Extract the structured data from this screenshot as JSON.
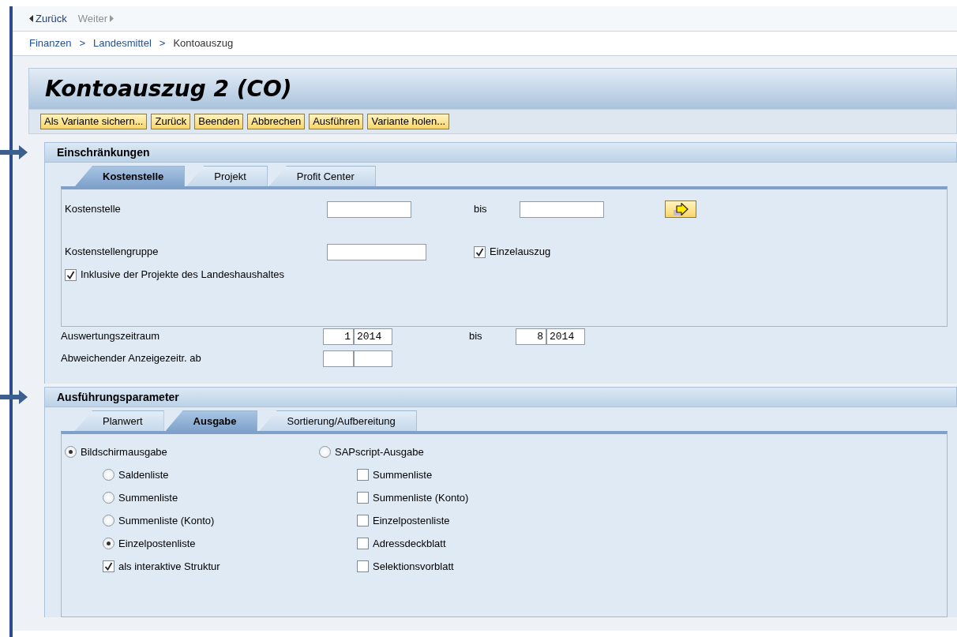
{
  "nav": {
    "back": "Zurück",
    "forward": "Weiter",
    "forward_disabled": true
  },
  "breadcrumb": [
    {
      "label": "Finanzen",
      "link": true
    },
    {
      "label": "Landesmittel",
      "link": true
    },
    {
      "label": "Kontoauszug",
      "link": false
    }
  ],
  "breadcrumb_separator": ">",
  "title": "Kontoauszug 2 (CO)",
  "toolbar": [
    "Als Variante sichern...",
    "Zurück",
    "Beenden",
    "Abbrechen",
    "Ausführen",
    "Variante holen..."
  ],
  "restrictions": {
    "title": "Einschränkungen",
    "tabs": [
      {
        "label": "Kostenstelle",
        "selected": true
      },
      {
        "label": "Projekt",
        "selected": false
      },
      {
        "label": "Profit Center",
        "selected": false
      }
    ],
    "rows": [
      {
        "kind": "range",
        "label": "Kostenstelle",
        "to_label": "bis"
      },
      {
        "kind": "field_check",
        "label": "Kostenstellengruppe",
        "check": {
          "label": "Einzelauszug",
          "checked": true
        }
      },
      {
        "kind": "check",
        "label": "Inklusive der Projekte des Landeshaushaltes",
        "checked": true
      }
    ],
    "periods": [
      {
        "label": "Auswertungszeitraum",
        "from": {
          "month": "1",
          "year": "2014"
        },
        "to_label": "bis",
        "to": {
          "month": "8",
          "year": "2014"
        }
      },
      {
        "label": "Abweichender Anzeigezeitr. ab"
      }
    ]
  },
  "execution": {
    "title": "Ausführungsparameter",
    "tabs": [
      {
        "label": "Planwert",
        "selected": false
      },
      {
        "label": "Ausgabe",
        "selected": true
      },
      {
        "label": "Sortierung/Aufbereitung",
        "selected": false
      }
    ],
    "columns": [
      {
        "kind": "radio",
        "label": "Bildschirmausgabe",
        "selected": true,
        "children": [
          {
            "kind": "radio",
            "label": "Saldenliste",
            "selected": false
          },
          {
            "kind": "radio",
            "label": "Summenliste",
            "selected": false
          },
          {
            "kind": "radio",
            "label": "Summenliste (Konto)",
            "selected": false
          },
          {
            "kind": "radio",
            "label": "Einzelpostenliste",
            "selected": true
          },
          {
            "kind": "check",
            "label": "als interaktive Struktur",
            "checked": true
          }
        ]
      },
      {
        "kind": "radio",
        "label": "SAPscript-Ausgabe",
        "selected": false,
        "children": [
          {
            "kind": "check",
            "label": "Summenliste",
            "checked": false
          },
          {
            "kind": "check",
            "label": "Summenliste (Konto)",
            "checked": false
          },
          {
            "kind": "check",
            "label": "Einzelpostenliste",
            "checked": false
          },
          {
            "kind": "check",
            "label": "Adressdeckblatt",
            "checked": false
          },
          {
            "kind": "check",
            "label": "Selektionsvorblatt",
            "checked": false
          }
        ]
      }
    ]
  }
}
